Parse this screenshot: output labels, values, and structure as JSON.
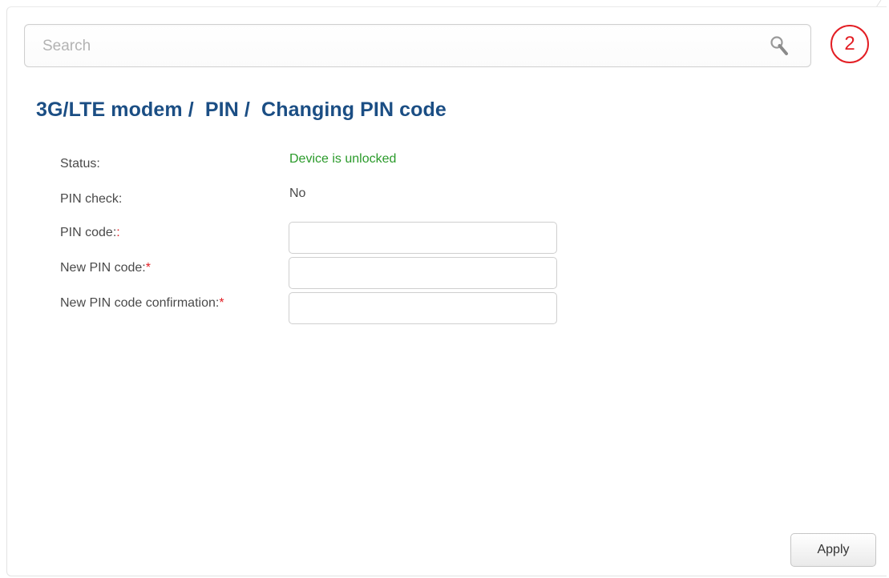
{
  "search": {
    "placeholder": "Search",
    "icon": "search-icon"
  },
  "notifications": {
    "count": "2",
    "color": "#e31e24"
  },
  "page": {
    "title": "3G/LTE modem /  PIN /  Changing PIN code"
  },
  "fields": {
    "status": {
      "label": "Status:",
      "value": "Device is unlocked",
      "color": "#2a9a2a"
    },
    "pin_check": {
      "label": "PIN check:",
      "value": "No"
    },
    "pin_code": {
      "label": "PIN code:",
      "suffix": ":",
      "value": ""
    },
    "new_pin_code": {
      "label": "New PIN code:",
      "required_marker": "*",
      "value": ""
    },
    "new_pin_confirmation": {
      "label": "New PIN code confirmation:",
      "required_marker": "*",
      "value": ""
    }
  },
  "actions": {
    "apply_label": "Apply"
  },
  "colors": {
    "title": "#1b4e84",
    "required": "#e31e24"
  }
}
